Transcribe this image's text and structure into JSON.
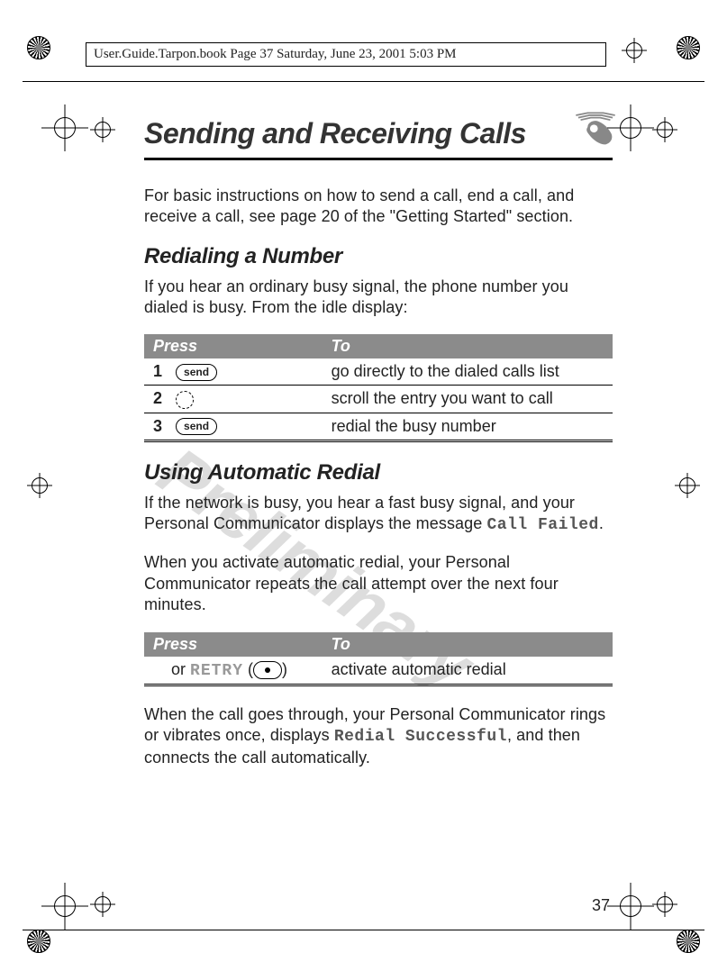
{
  "header_line": "User.Guide.Tarpon.book  Page 37  Saturday, June 23, 2001  5:03 PM",
  "chapter_title": "Sending and Receiving Calls",
  "intro": "For basic instructions on how to send a call, end a call, and receive a call, see page 20 of the \"Getting Started\" section.",
  "watermark": "Preliminary",
  "page_number": "37",
  "section1": {
    "heading": "Redialing a Number",
    "text": "If you hear an ordinary busy signal, the phone number you dialed is busy. From the idle display:",
    "table": {
      "head_press": "Press",
      "head_to": "To",
      "rows": [
        {
          "num": "1",
          "press_icon": "send",
          "to": "go directly to the dialed calls list"
        },
        {
          "num": "2",
          "press_icon": "nav",
          "to": "scroll the entry you want to call"
        },
        {
          "num": "3",
          "press_icon": "send",
          "to": "redial the busy number"
        }
      ]
    }
  },
  "section2": {
    "heading": "Using Automatic Redial",
    "para1_a": "If the network is busy, you hear a fast busy signal, and your Personal Communicator displays the message ",
    "para1_lcd": "Call Failed",
    "para1_b": ".",
    "para2": "When you activate automatic redial, your Personal Communicator repeats the call attempt over the next four minutes.",
    "table": {
      "head_press": "Press",
      "head_to": "To",
      "row": {
        "or": "or ",
        "retry": "RETRY",
        "paren_open": " (",
        "paren_close": ")",
        "to": "activate automatic redial"
      }
    },
    "para3_a": "When the call goes through, your Personal Communicator rings or vibrates once, displays ",
    "para3_lcd": "Redial Successful",
    "para3_b": ", and then connects the call automatically."
  }
}
